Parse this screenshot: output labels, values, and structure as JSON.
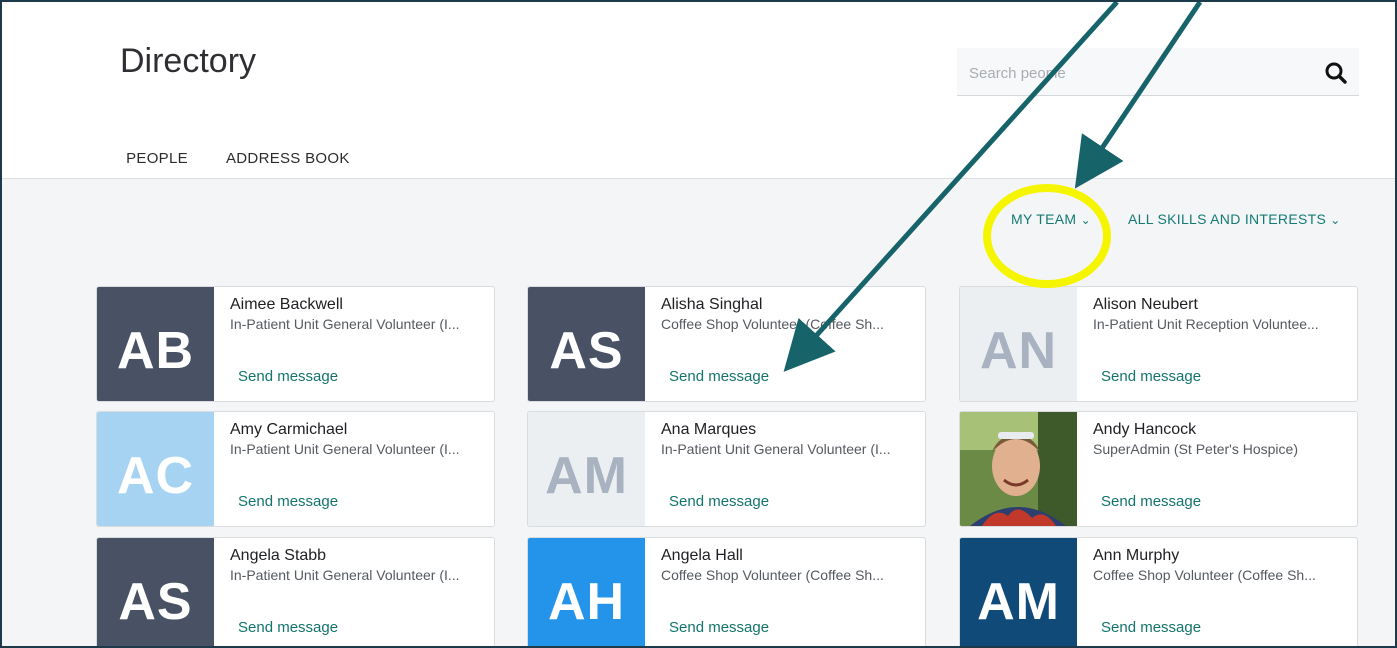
{
  "header": {
    "title": "Directory",
    "search_placeholder": "Search people",
    "search_icon": "search-icon"
  },
  "tabs": [
    {
      "label": "PEOPLE",
      "active": true
    },
    {
      "label": "ADDRESS BOOK",
      "active": false
    }
  ],
  "filters": {
    "team": "MY TEAM",
    "skills": "ALL SKILLS AND INTERESTS",
    "chevron": "⌄"
  },
  "people": [
    {
      "initials": "AB",
      "name": "Aimee Backwell",
      "role": "In-Patient Unit General Volunteer (I...",
      "action": "Send message",
      "bg": "#495264",
      "fg": "#ffffff"
    },
    {
      "initials": "AS",
      "name": "Alisha Singhal",
      "role": "Coffee Shop Volunteer (Coffee Sh...",
      "action": "Send message",
      "bg": "#495264",
      "fg": "#ffffff"
    },
    {
      "initials": "AN",
      "name": "Alison Neubert",
      "role": "In-Patient Unit Reception Voluntee...",
      "action": "Send message",
      "bg": "#eceff2",
      "fg": "#a8b2c1"
    },
    {
      "initials": "AC",
      "name": "Amy Carmichael",
      "role": "In-Patient Unit General Volunteer (I...",
      "action": "Send message",
      "bg": "#a7d3f3",
      "fg": "#ffffff"
    },
    {
      "initials": "AM",
      "name": "Ana Marques",
      "role": "In-Patient Unit General Volunteer (I...",
      "action": "Send message",
      "bg": "#eceff2",
      "fg": "#a8b2c1"
    },
    {
      "initials": "",
      "name": "Andy Hancock",
      "role": "SuperAdmin (St Peter's Hospice)",
      "action": "Send message",
      "bg": "#5f7d3a",
      "fg": "#ffffff",
      "photo": true
    },
    {
      "initials": "AS",
      "name": "Angela Stabb",
      "role": "In-Patient Unit General Volunteer (I...",
      "action": "Send message",
      "bg": "#495264",
      "fg": "#ffffff"
    },
    {
      "initials": "AH",
      "name": "Angela Hall",
      "role": "Coffee Shop Volunteer (Coffee Sh...",
      "action": "Send message",
      "bg": "#2394ea",
      "fg": "#ffffff"
    },
    {
      "initials": "AM",
      "name": "Ann Murphy",
      "role": "Coffee Shop Volunteer (Coffee Sh...",
      "action": "Send message",
      "bg": "#0f4a78",
      "fg": "#ffffff"
    }
  ],
  "annotations": {
    "arrow_color": "#17636a",
    "highlight_color": "#f5f500"
  }
}
